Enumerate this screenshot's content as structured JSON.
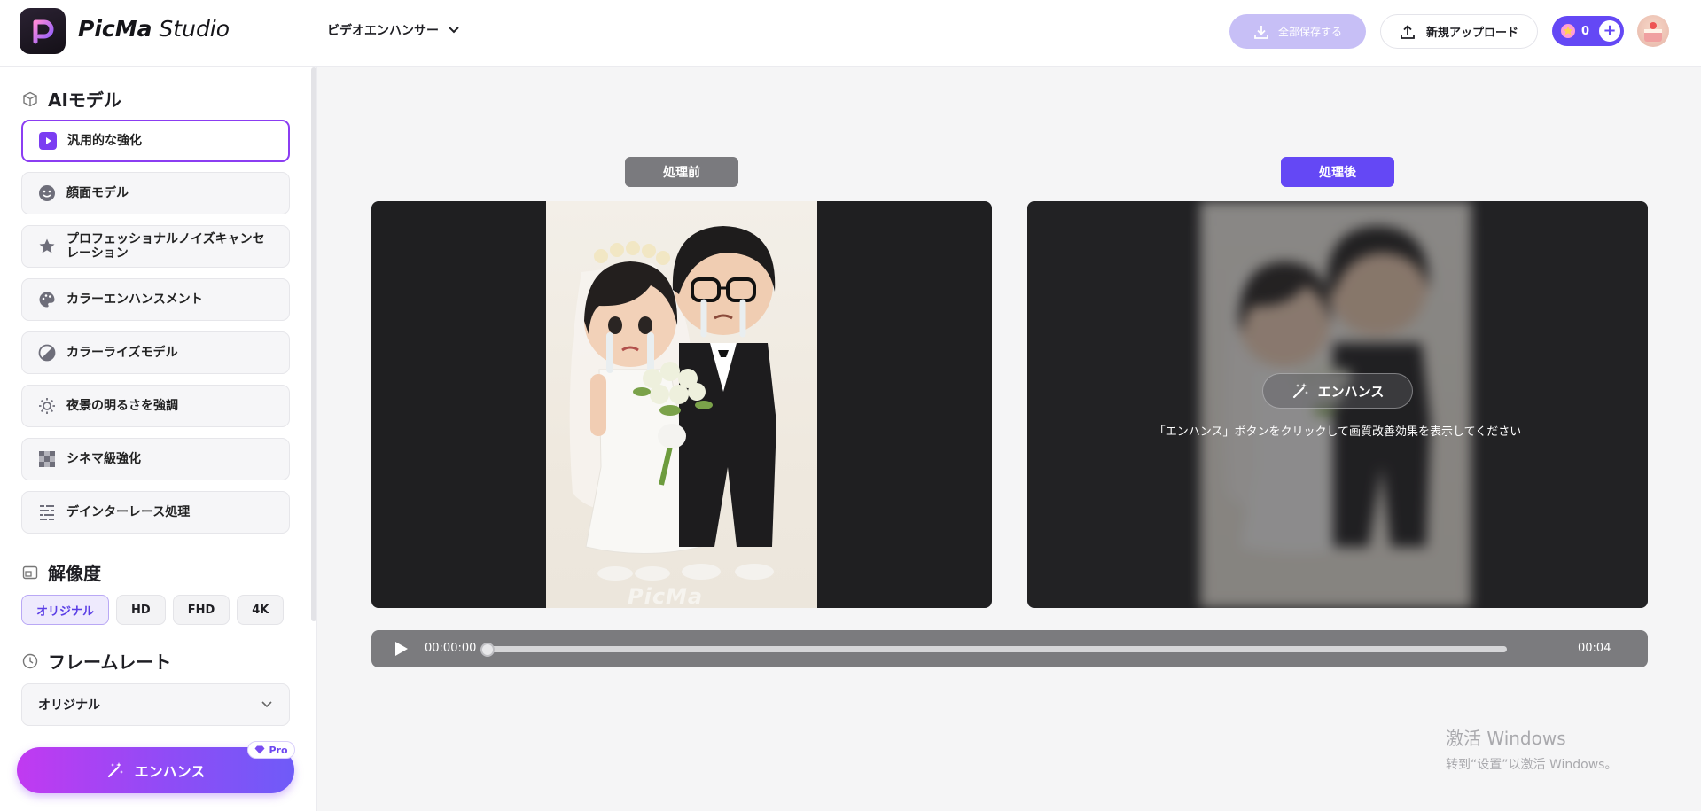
{
  "header": {
    "brand_name": "PicMa",
    "brand_suffix": "Studio",
    "tool_menu_label": "ビデオエンハンサー",
    "save_all_label": "全部保存する",
    "upload_label": "新規アップロード",
    "credits": "0"
  },
  "sidebar": {
    "ai_model_title": "AIモデル",
    "models": [
      {
        "label": "汎用的な強化",
        "icon": "play-icon"
      },
      {
        "label": "顔面モデル",
        "icon": "face-icon"
      },
      {
        "label": "プロフェッショナルノイズキャンセレーション",
        "icon": "star-icon"
      },
      {
        "label": "カラーエンハンスメント",
        "icon": "palette-icon"
      },
      {
        "label": "カラーライズモデル",
        "icon": "colorize-icon"
      },
      {
        "label": "夜景の明るさを強調",
        "icon": "brightness-icon"
      },
      {
        "label": "シネマ級強化",
        "icon": "checker-icon"
      },
      {
        "label": "デインターレース処理",
        "icon": "lines-icon"
      }
    ],
    "resolution_title": "解像度",
    "resolutions": [
      "オリジナル",
      "HD",
      "FHD",
      "4K"
    ],
    "framerate_title": "フレームレート",
    "framerate_value": "オリジナル",
    "enhance_label": "エンハンス",
    "pro_badge": "Pro"
  },
  "main": {
    "before_label": "処理前",
    "after_label": "処理後",
    "watermark": "PicMa",
    "overlay_button": "エンハンス",
    "overlay_hint": "「エンハンス」ボタンをクリックして画質改善効果を表示してください",
    "player": {
      "current_time": "00:00:00",
      "end_time": "00:04"
    }
  },
  "system": {
    "activate_title": "激活 Windows",
    "activate_sub": "转到“设置”以激活 Windows。"
  },
  "colors": {
    "accent": "#6448f5",
    "active_border": "#8b3df2",
    "enhance_gradient_start": "#c13af1",
    "enhance_gradient_end": "#6f5bf8"
  }
}
